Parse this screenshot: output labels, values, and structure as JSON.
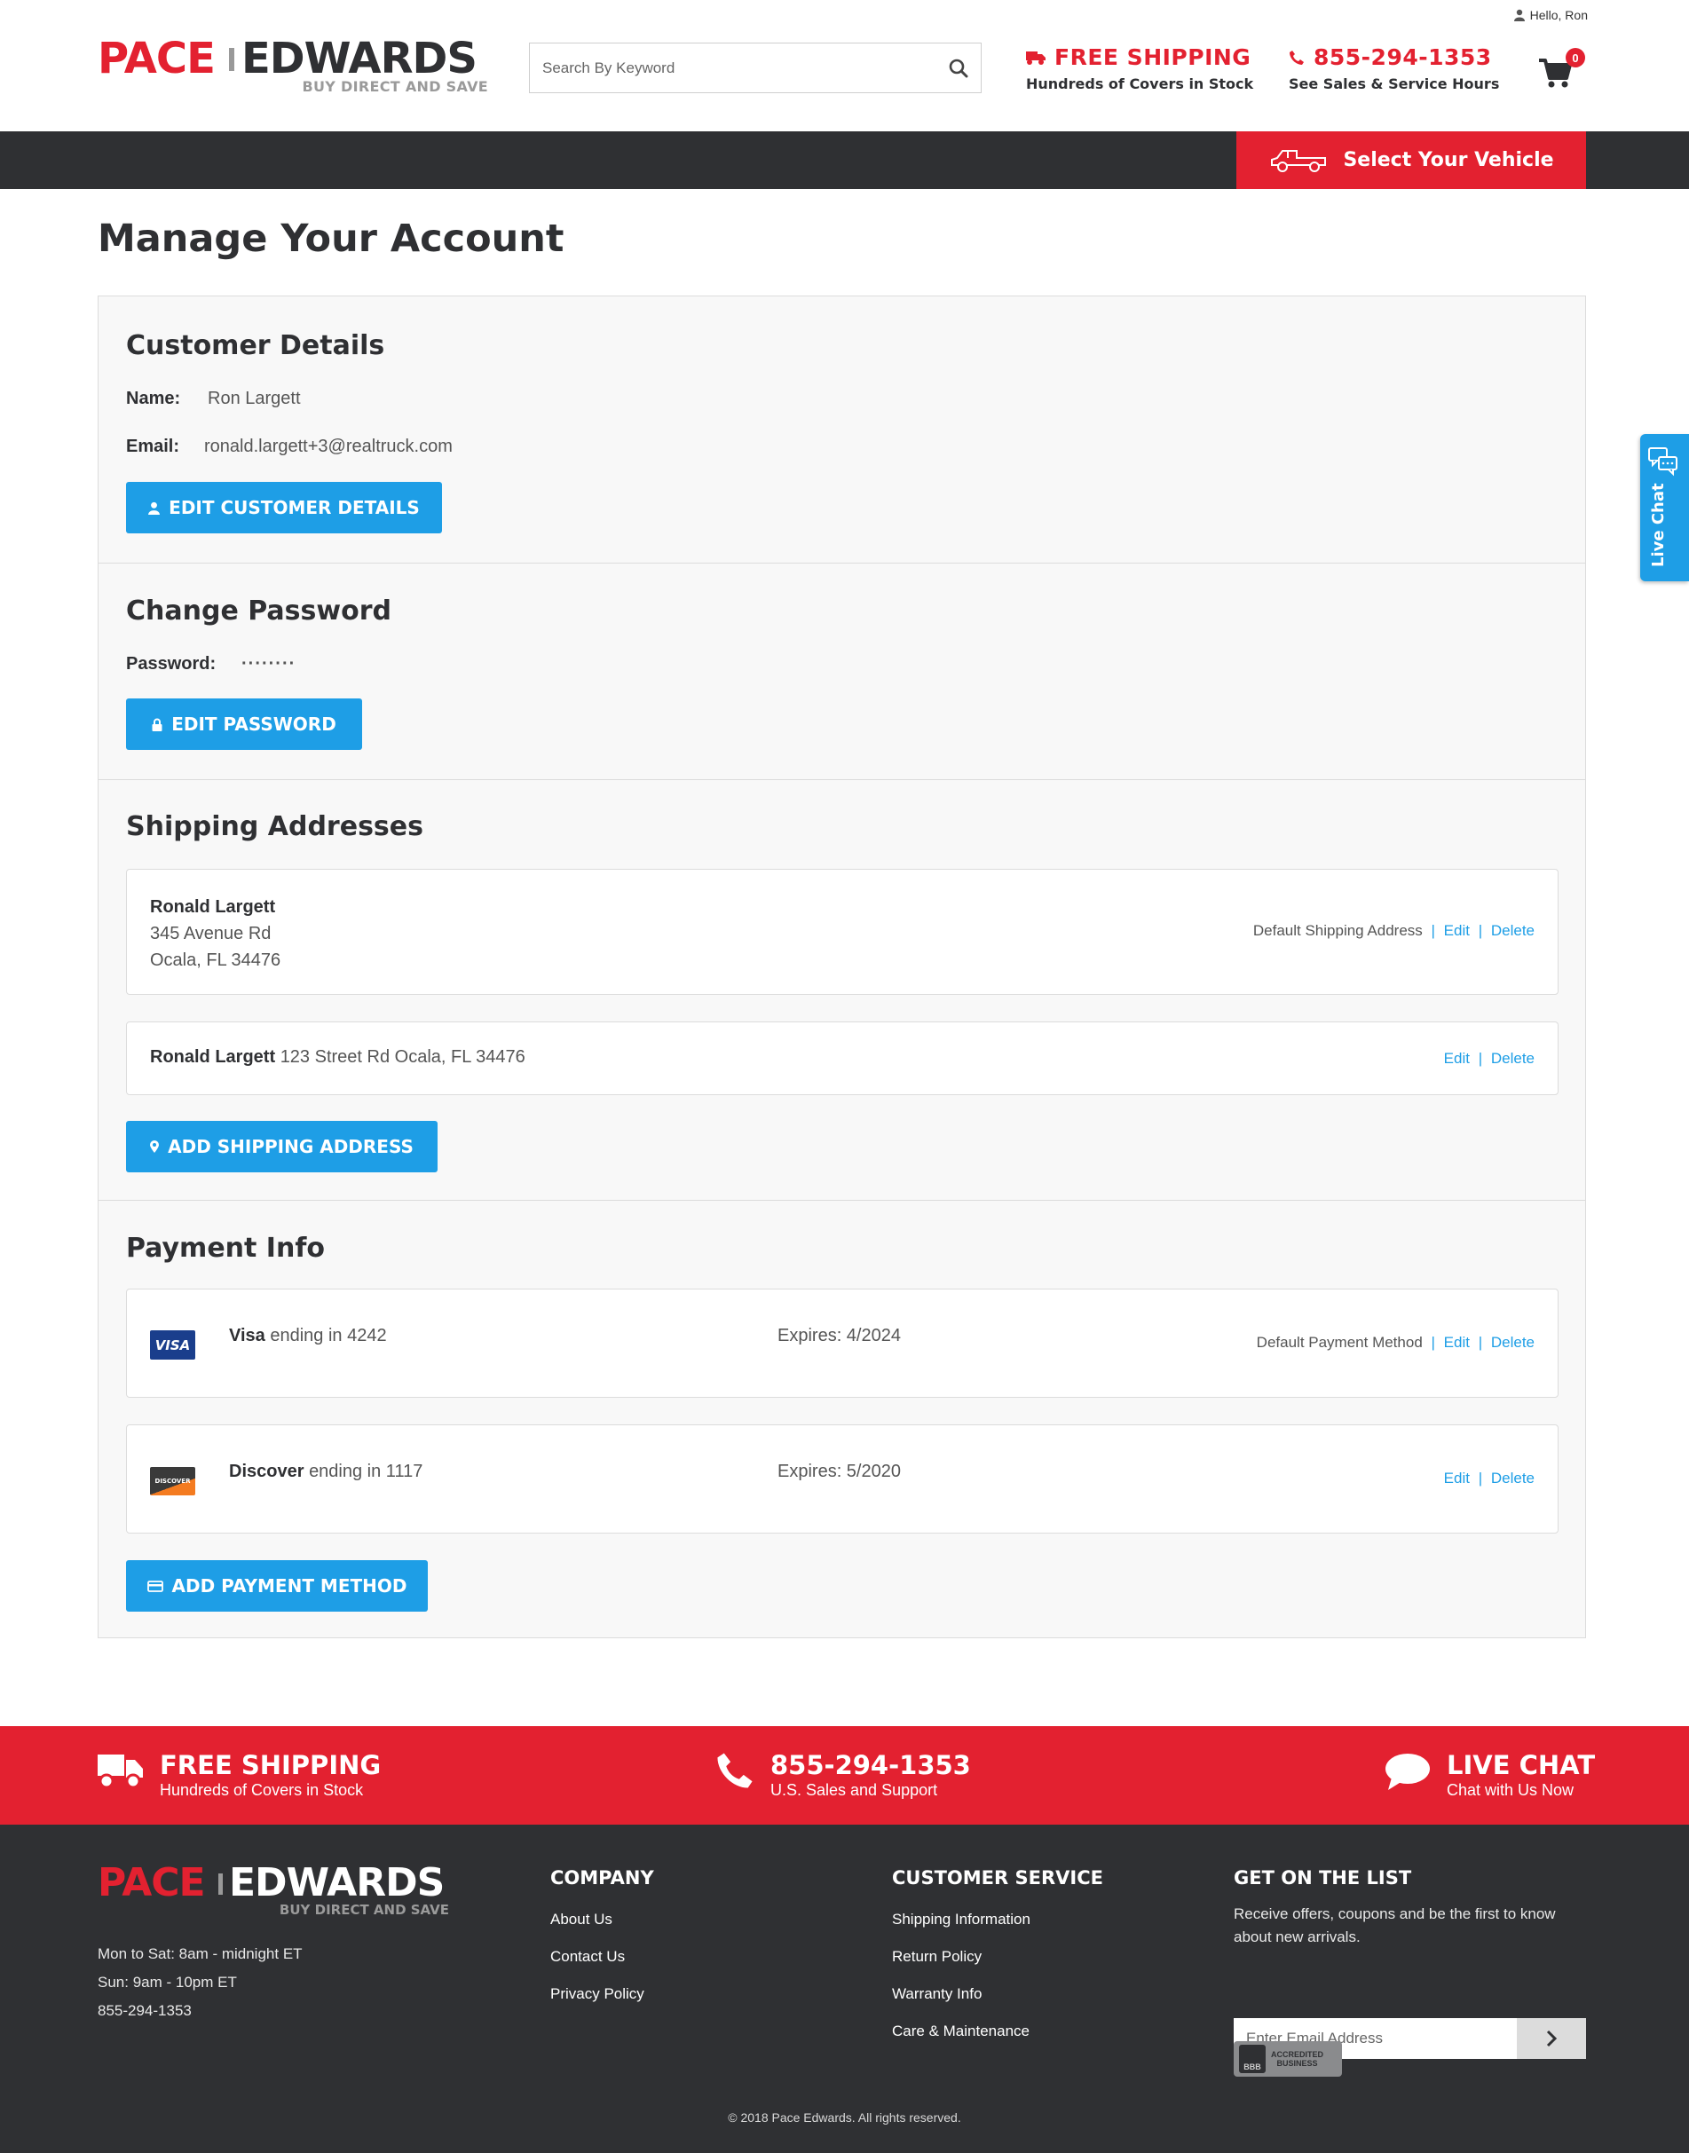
{
  "header": {
    "greeting": "Hello, Ron",
    "logo": {
      "pace": "PACE",
      "edwards": "EDWARDS",
      "tagline": "BUY DIRECT AND SAVE"
    },
    "search_placeholder": "Search By Keyword",
    "shipping": {
      "title": "FREE SHIPPING",
      "subtitle": "Hundreds of Covers in Stock"
    },
    "phone": {
      "number": "855-294-1353",
      "subtitle": "See Sales & Service Hours"
    },
    "cart_count": "0",
    "vehicle_button": "Select Your Vehicle"
  },
  "page": {
    "title": "Manage Your Account"
  },
  "customer_details": {
    "title": "Customer Details",
    "name_label": "Name:",
    "name_value": "Ron Largett",
    "email_label": "Email:",
    "email_value": "ronald.largett+3@realtruck.com",
    "edit_button": "EDIT CUSTOMER DETAILS"
  },
  "change_password": {
    "title": "Change Password",
    "password_label": "Password:",
    "password_value": "········",
    "edit_button": "EDIT PASSWORD"
  },
  "shipping_addresses": {
    "title": "Shipping Addresses",
    "addresses": [
      {
        "name": "Ronald Largett",
        "line1": "345 Avenue Rd",
        "line2": "Ocala, FL 34476",
        "default_label": "Default Shipping  Address",
        "edit": "Edit",
        "delete": "Delete"
      },
      {
        "name": "Ronald Largett",
        "inline": "123 Street Rd Ocala, FL 34476",
        "edit": "Edit",
        "delete": "Delete"
      }
    ],
    "add_button": "ADD SHIPPING ADDRESS"
  },
  "payment_info": {
    "title": "Payment Info",
    "cards": [
      {
        "brand": "Visa",
        "ending": "ending in 4242",
        "expires": "Expires: 4/2024",
        "default_label": "Default Payment  Method",
        "edit": "Edit",
        "delete": "Delete",
        "logo_text": "VISA"
      },
      {
        "brand": "Discover",
        "ending": "ending in 1117",
        "expires": "Expires: 5/2020",
        "edit": "Edit",
        "delete": "Delete",
        "logo_text": "DISCOVER"
      }
    ],
    "add_button": "ADD PAYMENT METHOD"
  },
  "live_chat_tab": "Live Chat",
  "footer_band": {
    "shipping": {
      "title": "FREE SHIPPING",
      "subtitle": "Hundreds of Covers in Stock"
    },
    "phone": {
      "title": "855-294-1353",
      "subtitle": "U.S. Sales and Support"
    },
    "chat": {
      "title": "LIVE CHAT",
      "subtitle": "Chat with Us Now"
    }
  },
  "footer": {
    "logo": {
      "pace": "PACE",
      "edwards": "EDWARDS",
      "tagline": "BUY DIRECT AND SAVE"
    },
    "hours": [
      "Mon to Sat:  8am - midnight ET",
      "Sun:  9am - 10pm ET",
      "855-294-1353"
    ],
    "company": {
      "title": "COMPANY",
      "links": [
        "About Us",
        "Contact Us",
        "Privacy Policy"
      ]
    },
    "customer_service": {
      "title": "CUSTOMER SERVICE",
      "links": [
        "Shipping Information",
        "Return Policy",
        "Warranty Info",
        "Care & Maintenance"
      ]
    },
    "newsletter": {
      "title": "GET ON THE LIST",
      "text": "Receive offers, coupons and be the first to know about new arrivals.",
      "placeholder": "Enter Email Address"
    },
    "bbb": {
      "seal": "BBB",
      "text1": "ACCREDITED",
      "text2": "BUSINESS"
    },
    "copyright": "© 2018 Pace Edwards. All rights reserved."
  },
  "colors": {
    "brand_red": "#e32130",
    "accent_blue": "#1e9ee6",
    "dark": "#2f3033"
  }
}
